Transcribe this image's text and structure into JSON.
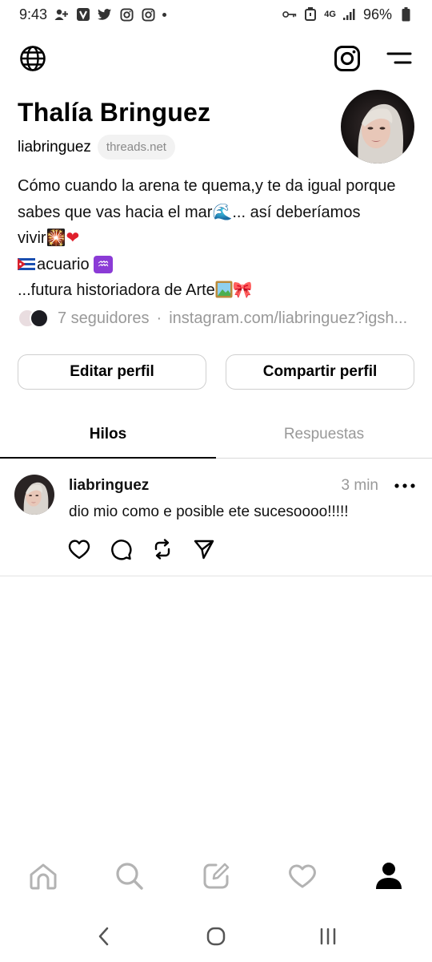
{
  "status_bar": {
    "time": "9:43",
    "battery": "96%",
    "network": "4G"
  },
  "profile": {
    "name": "Thalía Bringuez",
    "handle": "liabringuez",
    "domain": "threads.net",
    "bio": {
      "line1": "Cómo cuando la arena te quema,y te da igual porque",
      "line2_a": "sabes que vas hacia el mar",
      "line2_emoji": "🌊",
      "line2_b": "... así deberíamos",
      "line3_a": "vivir",
      "line3_emoji1": "🎇",
      "line3_emoji2": "❤",
      "line4_text": "acuario ",
      "line4_emoji": "♒",
      "line5_text": "...futura historiadora de Arte",
      "line5_emoji2": "🎀"
    },
    "followers_text": "7 seguidores",
    "separator": "·",
    "link": "instagram.com/liabringuez?igsh..."
  },
  "buttons": {
    "edit": "Editar perfil",
    "share": "Compartir perfil"
  },
  "tabs": [
    {
      "label": "Hilos",
      "active": true
    },
    {
      "label": "Respuestas",
      "active": false
    }
  ],
  "post": {
    "username": "liabringuez",
    "time": "3 min",
    "text": "dio mio como e posible ete sucesoooo!!!!!"
  },
  "icons": {
    "topbar": [
      "globe-icon",
      "instagram-icon",
      "menu-icon"
    ],
    "post_actions": [
      "heart-icon",
      "comment-icon",
      "repost-icon",
      "share-icon"
    ],
    "bottom_nav": [
      "home-icon",
      "search-icon",
      "compose-icon",
      "activity-heart-icon",
      "profile-icon"
    ],
    "system_nav": [
      "back-icon",
      "home-circle-icon",
      "recents-icon"
    ]
  },
  "colors": {
    "text": "#000000",
    "muted": "#999999",
    "border": "#d9d9d9",
    "heart_emoji": "#e0202c"
  }
}
